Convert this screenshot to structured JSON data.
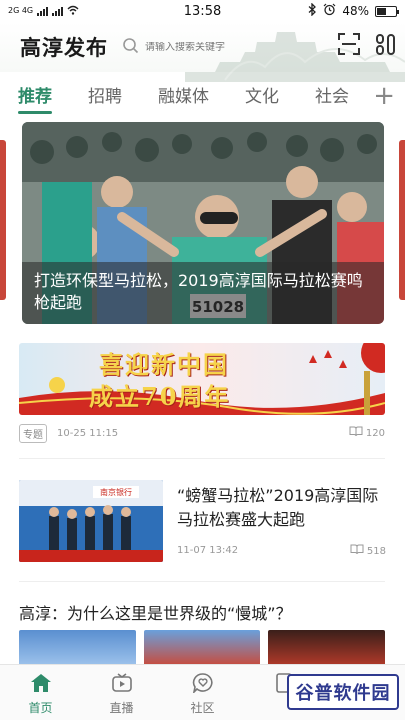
{
  "status_bar": {
    "signal_left": "2G 4G",
    "network_label": "4G",
    "time": "13:58",
    "battery": "48%",
    "battery_level": 0.48
  },
  "header": {
    "app_title": "高淳发布",
    "search_placeholder": "请输入搜索关键字",
    "scan_icon": "scan-icon",
    "more_icon": "menu-icon"
  },
  "tabs": [
    {
      "label": "推荐",
      "active": true
    },
    {
      "label": "招聘",
      "active": false
    },
    {
      "label": "融媒体",
      "active": false
    },
    {
      "label": "文化",
      "active": false
    },
    {
      "label": "社会",
      "active": false
    }
  ],
  "tab_add_label": "+",
  "hero": {
    "caption": "打造环保型马拉松，2019高淳国际马拉松赛鸣枪起跑",
    "bib_number": "51028"
  },
  "banner": {
    "line1": "喜迎新中国",
    "line2": "成立70周年",
    "tag": "专题",
    "time": "10-25 11:15",
    "reads": "120"
  },
  "news2": {
    "title": "“螃蟹马拉松”2019高淳国际马拉松赛盛大起跑",
    "time": "11-07 13:42",
    "reads": "518",
    "thumb_text": "南京银行"
  },
  "news3": {
    "title": "高淳：为什么这里是世界级的“慢城”？"
  },
  "bottom_nav": [
    {
      "label": "首页",
      "icon": "home-icon",
      "active": true
    },
    {
      "label": "直播",
      "icon": "tv-icon",
      "active": false
    },
    {
      "label": "社区",
      "icon": "heart-chat-icon",
      "active": false
    },
    {
      "label": "",
      "icon": "doc-icon",
      "active": false
    }
  ],
  "watermark": "谷普软件园",
  "colors": {
    "accent": "#2e8b6a",
    "banner_red": "#c8251c",
    "banner_gold": "#f6d34a"
  }
}
